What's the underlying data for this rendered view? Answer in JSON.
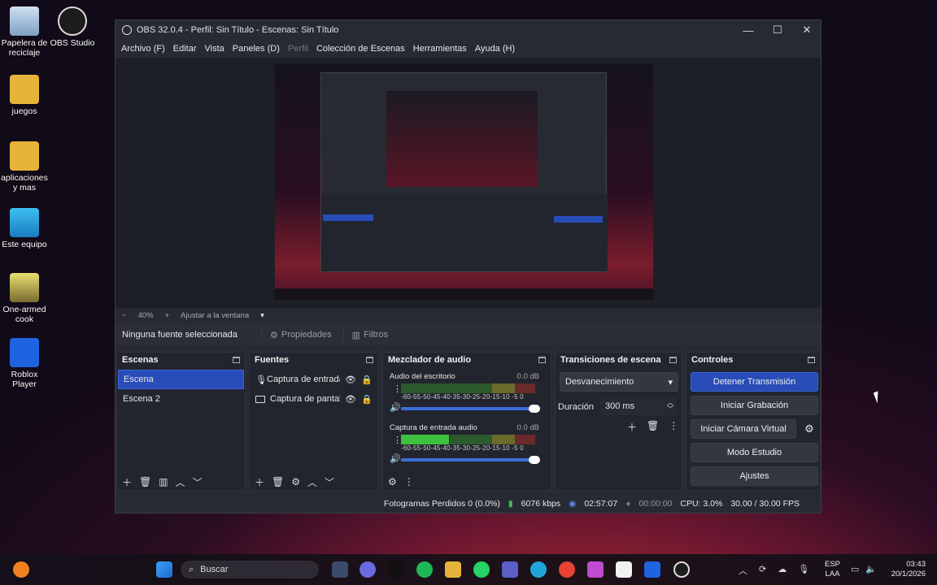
{
  "desktop": {
    "icons": [
      {
        "label": "Papelera de reciclaje",
        "color": "#9fb8d8"
      },
      {
        "label": "OBS Studio",
        "color": "#2a2a2a"
      },
      {
        "label": "juegos",
        "color": "#e6b43a"
      },
      {
        "label": "aplicaciones y mas",
        "color": "#e6b43a"
      },
      {
        "label": "Este equipo",
        "color": "#2aa7e0"
      },
      {
        "label": "One-armed cook",
        "color": "#c9c24a"
      },
      {
        "label": "Roblox Player",
        "color": "#1e63e0"
      }
    ]
  },
  "window": {
    "title": "OBS 32.0.4 - Perfil: Sin Título - Escenas: Sin Título"
  },
  "menu": [
    "Archivo (F)",
    "Editar",
    "Vista",
    "Paneles (D)",
    "Perfil",
    "Colección de Escenas",
    "Herramientas",
    "Ayuda (H)"
  ],
  "zoom": {
    "minus": "−",
    "level": "40%",
    "plus": "+",
    "fit": "Ajustar a la ventana"
  },
  "source_toolbar": {
    "none_selected": "Ninguna fuente seleccionada",
    "properties": "Propiedades",
    "filters": "Filtros"
  },
  "scenes": {
    "title": "Escenas",
    "items": [
      "Escena",
      "Escena 2"
    ],
    "selected": 0
  },
  "sources": {
    "title": "Fuentes",
    "items": [
      {
        "label": "Captura de entrada de audio",
        "icon": "microphone-icon"
      },
      {
        "label": "Captura de pantalla",
        "icon": "monitor-icon"
      }
    ]
  },
  "mixer": {
    "title": "Mezclador de audio",
    "ticks": "-60-55-50-45-40-35-30-25-20-15-10 -5  0",
    "channels": [
      {
        "name": "Audio del escritorio",
        "db": "0.0 dB",
        "level": 0.0
      },
      {
        "name": "Captura de entrada audio",
        "db": "0.0 dB",
        "level": 0.35
      }
    ]
  },
  "transitions": {
    "title": "Transiciones de escena",
    "selected": "Desvanecimiento",
    "duration_label": "Duración",
    "duration_value": "300 ms"
  },
  "controls": {
    "title": "Controles",
    "stop_stream": "Detener Transmisión",
    "start_record": "Iniciar Grabación",
    "virtual_cam": "Iniciar Cámara Virtual",
    "studio_mode": "Modo Estudio",
    "settings": "Ajustes"
  },
  "status": {
    "dropped": "Fotogramas Perdidos 0 (0.0%)",
    "bitrate": "6076 kbps",
    "stream_time": "02:57:07",
    "record_time": "00:00:00",
    "cpu": "CPU: 3.0%",
    "fps": "30.00 / 30.00 FPS"
  },
  "taskbar": {
    "search": "Buscar",
    "lang1": "ESP",
    "lang2": "LAA",
    "time": "03:43",
    "date": "20/1/2026"
  },
  "colors": {
    "accent": "#284cb8",
    "window_bg": "#272a33",
    "dock_bg": "#22252e"
  }
}
